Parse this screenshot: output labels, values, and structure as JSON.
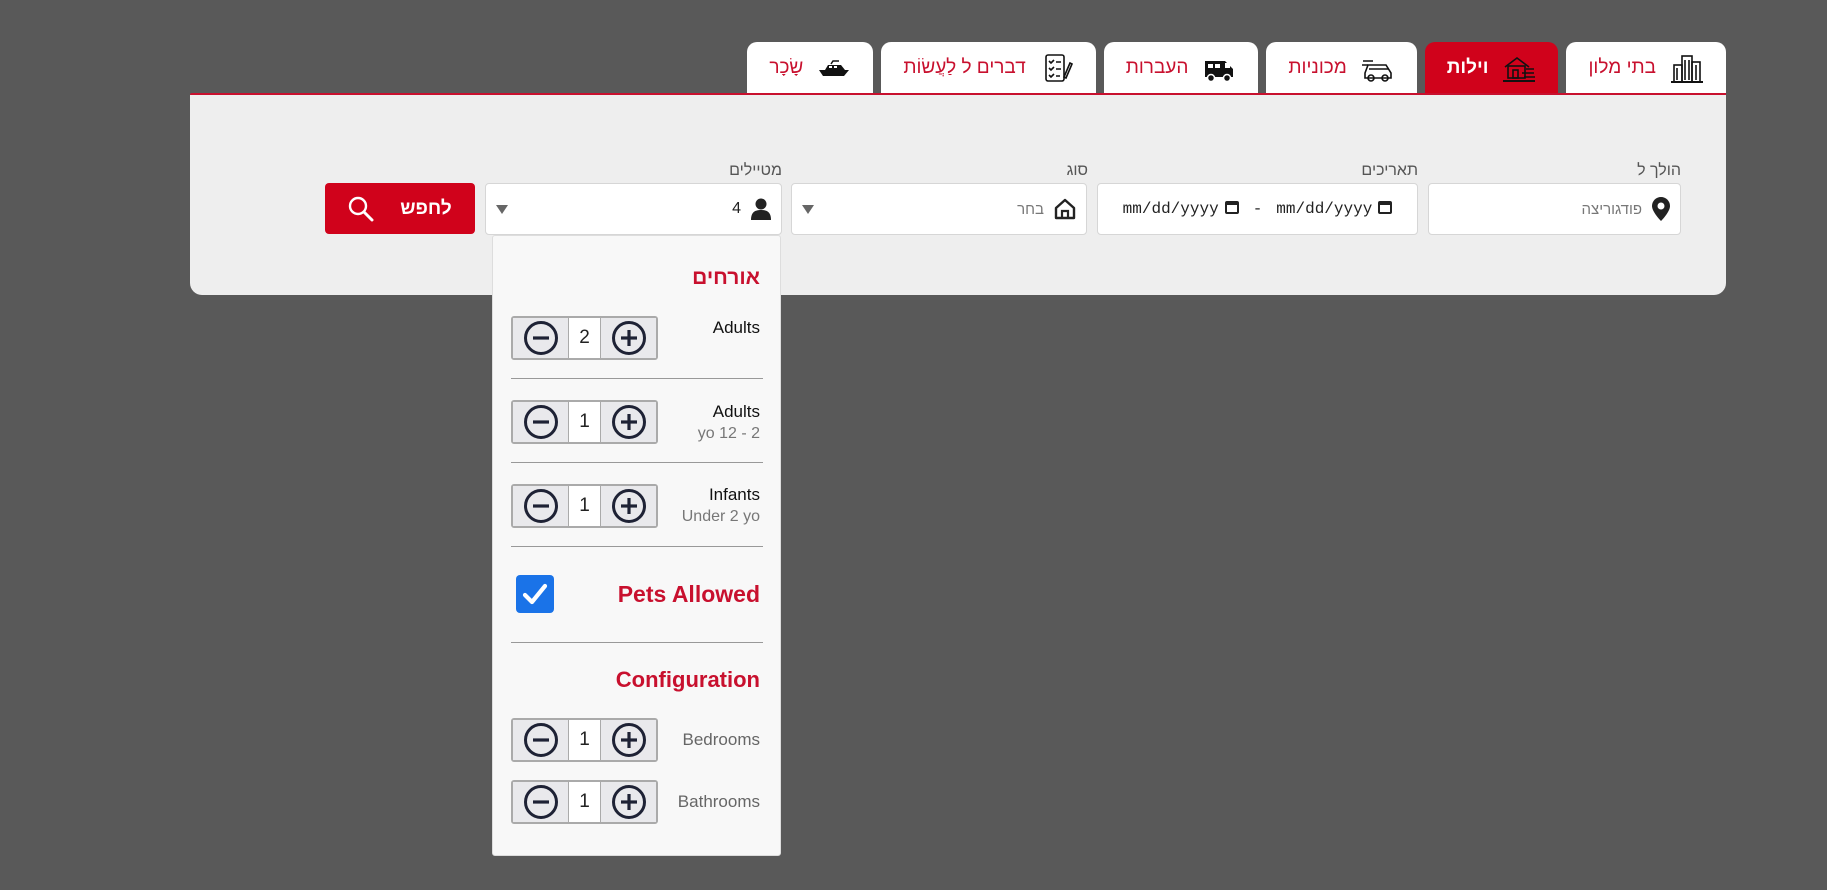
{
  "tabs": [
    {
      "label": "בתי מלון",
      "icon": "buildings-icon",
      "active": false
    },
    {
      "label": "וילות",
      "icon": "villa-icon",
      "active": true
    },
    {
      "label": "מכוניות",
      "icon": "car-icon",
      "active": false
    },
    {
      "label": "העברות",
      "icon": "van-icon",
      "active": false
    },
    {
      "label": "דברים ל לַעֲשׂוֹת",
      "icon": "checklist-icon",
      "active": false
    },
    {
      "label": "שָׂכָר",
      "icon": "yacht-icon",
      "active": false
    }
  ],
  "search": {
    "destination_label": "הולך ל",
    "destination_placeholder": "פודגוריצה",
    "dates_label": "תאריכים",
    "date_from": "mm/dd/yyyy",
    "date_sep": "-",
    "date_to": "mm/dd/yyyy",
    "type_label": "סוג",
    "type_value": "בחר",
    "travelers_label": "מטיילים",
    "travelers_value": "4",
    "search_button": "לחפש"
  },
  "dropdown": {
    "guests_heading": "אורחים",
    "rows": [
      {
        "label": "Adults",
        "sub": "",
        "value": "2"
      },
      {
        "label": "Adults",
        "sub": "yo 12 - 2",
        "value": "1"
      },
      {
        "label": "Infants",
        "sub": "Under 2 yo",
        "value": "1"
      }
    ],
    "pets_label": "Pets Allowed",
    "pets_checked": true,
    "config_heading": "Configuration",
    "config_rows": [
      {
        "label": "Bedrooms",
        "value": "1"
      },
      {
        "label": "Bathrooms",
        "value": "1"
      }
    ]
  },
  "colors": {
    "accent": "#d0021b",
    "background": "#595959",
    "panel": "#eeeeee",
    "checkbox": "#1a73e8"
  }
}
